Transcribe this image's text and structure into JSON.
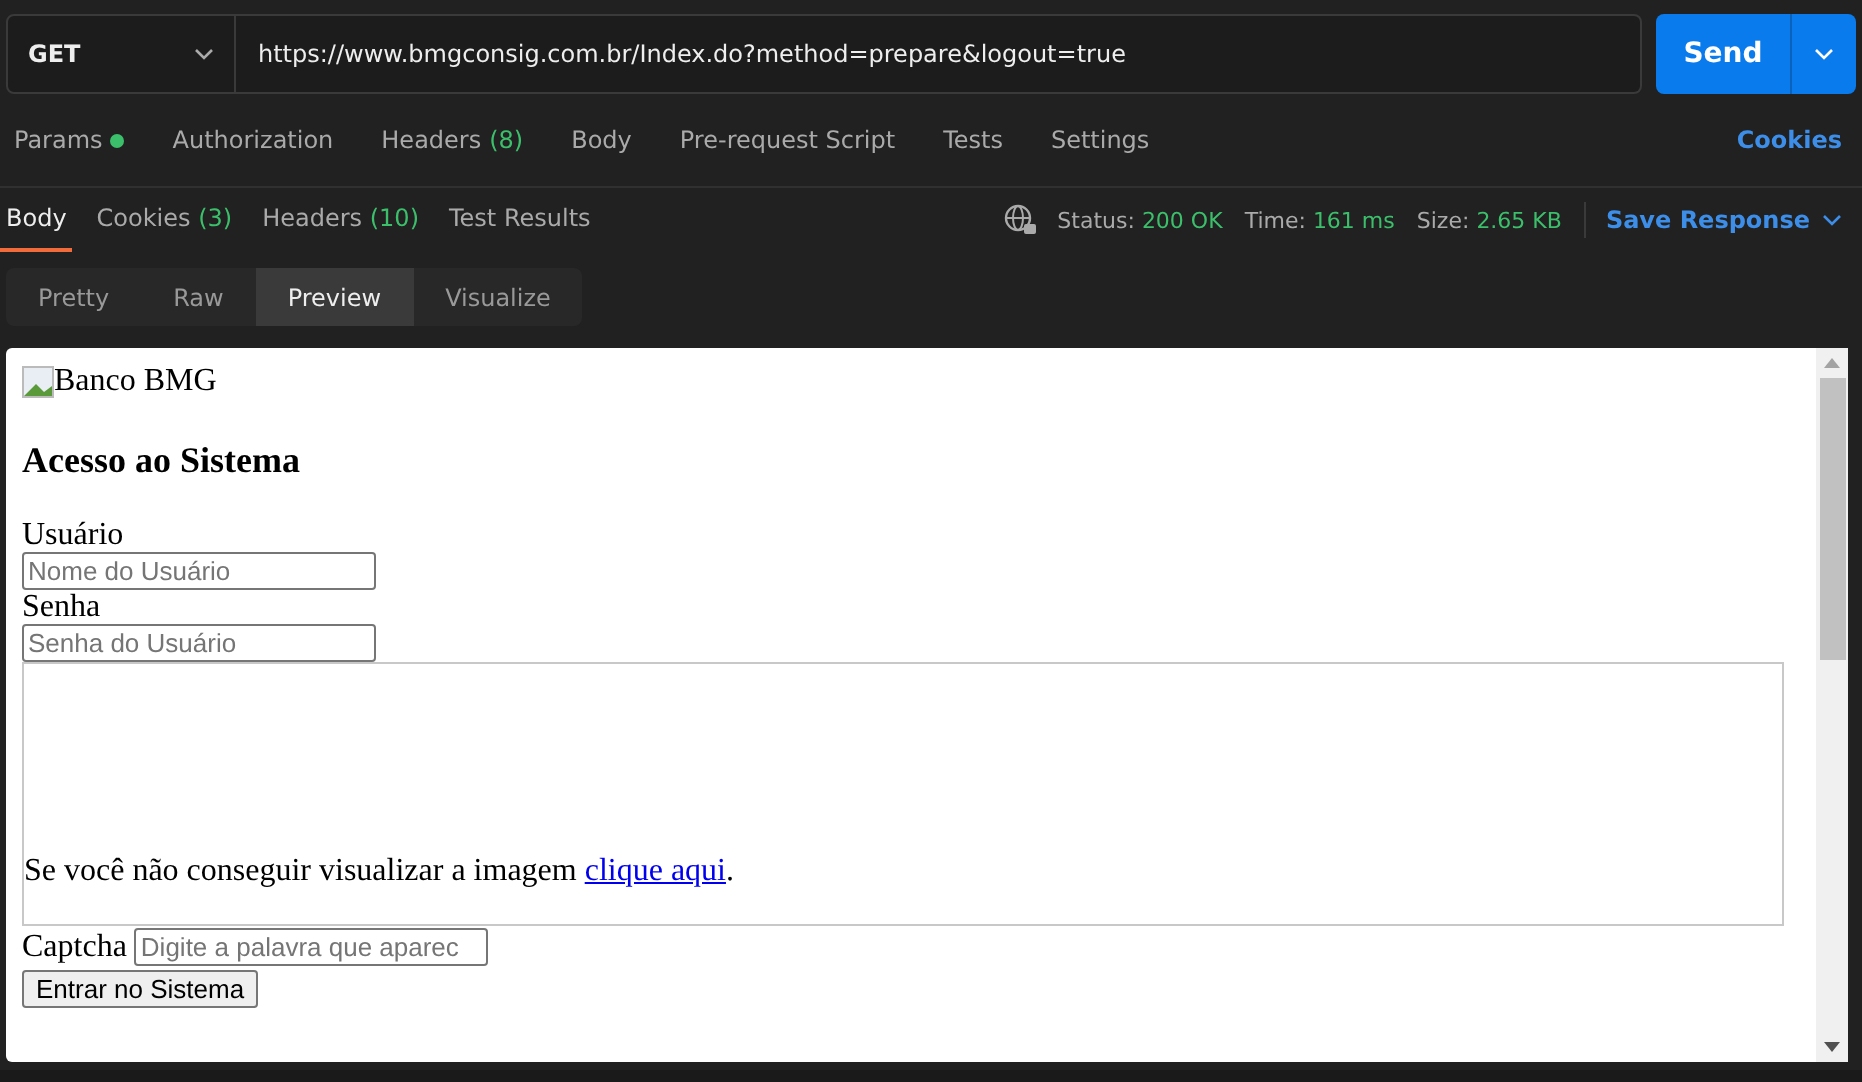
{
  "request": {
    "method": "GET",
    "url": "https://www.bmgconsig.com.br/Index.do?method=prepare&logout=true",
    "send": "Send"
  },
  "request_tabs": [
    {
      "label": "Params",
      "dot": true
    },
    {
      "label": "Authorization",
      "dot": false
    },
    {
      "label": "Headers",
      "count": "(8)",
      "dot": false
    },
    {
      "label": "Body",
      "dot": false
    },
    {
      "label": "Pre-request Script",
      "dot": false
    },
    {
      "label": "Tests",
      "dot": false
    },
    {
      "label": "Settings",
      "dot": false
    }
  ],
  "cookies_link": "Cookies",
  "response_tabs": [
    {
      "label": "Body",
      "selected": true
    },
    {
      "label": "Cookies",
      "count": "(3)",
      "selected": false
    },
    {
      "label": "Headers",
      "count": "(10)",
      "selected": false
    },
    {
      "label": "Test Results",
      "selected": false
    }
  ],
  "response_meta": [
    {
      "label": "Status:",
      "value": "200 OK"
    },
    {
      "label": "Time:",
      "value": "161 ms"
    },
    {
      "label": "Size:",
      "value": "2.65 KB"
    }
  ],
  "save_response": "Save Response",
  "view_modes": [
    {
      "label": "Pretty",
      "selected": false
    },
    {
      "label": "Raw",
      "selected": false
    },
    {
      "label": "Preview",
      "selected": true
    },
    {
      "label": "Visualize",
      "selected": false
    }
  ],
  "preview": {
    "image_alt": "Banco BMG",
    "heading": "Acesso ao Sistema",
    "fields": [
      {
        "label": "Usuário",
        "placeholder": "Nome do Usuário"
      },
      {
        "label": "Senha",
        "placeholder": "Senha do Usuário"
      }
    ],
    "captcha_note": {
      "text": "Se você não conseguir visualizar a imagem ",
      "link": "clique aqui",
      "after": "."
    },
    "captcha": {
      "label": "Captcha",
      "placeholder": "Digite a palavra que aparec"
    },
    "submit": "Entrar no Sistema"
  }
}
